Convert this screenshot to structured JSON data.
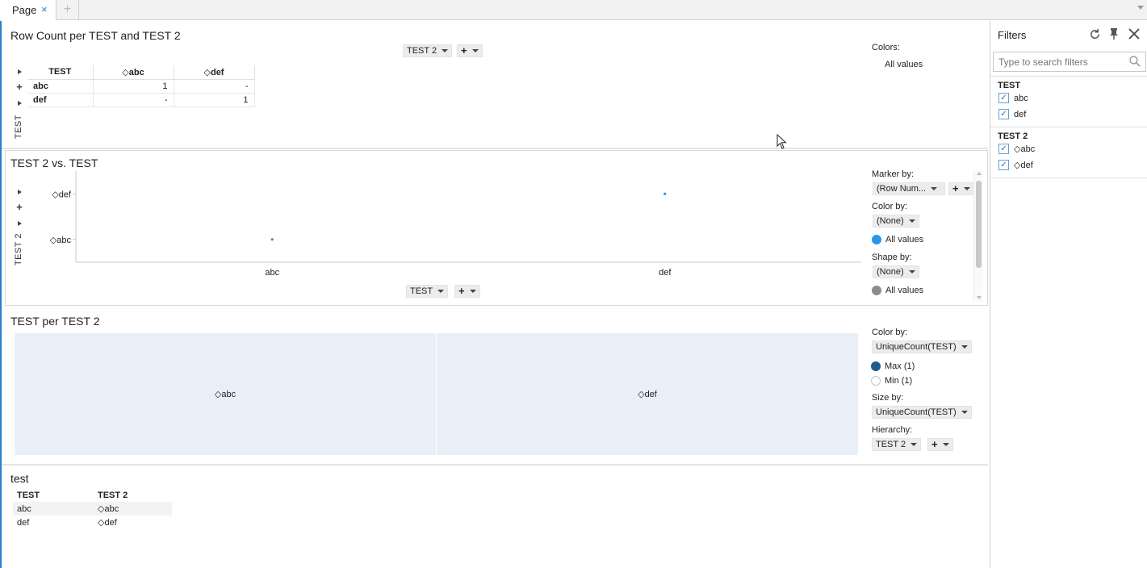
{
  "tabs": {
    "page_label": "Page",
    "close_icon": "×",
    "add_icon": "+"
  },
  "crosstable": {
    "title": "Row Count per TEST and TEST 2",
    "column_axis_label": "TEST 2",
    "row_axis_label": "TEST",
    "headers": [
      "TEST",
      "◇abc",
      "◇def"
    ],
    "rows": [
      {
        "label": "abc",
        "values": [
          "1",
          "-"
        ]
      },
      {
        "label": "def",
        "values": [
          "-",
          "1"
        ]
      }
    ],
    "legend_title": "Colors:",
    "legend_value": "All values"
  },
  "scatter": {
    "title": "TEST 2 vs. TEST",
    "x_axis_selector": "TEST",
    "y_axis_label": "TEST 2",
    "marker_by_label": "Marker by:",
    "marker_by_value": "(Row Num...",
    "color_by_label": "Color by:",
    "color_by_value": "(None)",
    "color_legend": "All values",
    "shape_by_label": "Shape by:",
    "shape_by_value": "(None)",
    "shape_legend": "All values",
    "marker_color": "#3b8fd6"
  },
  "chart_data": {
    "type": "scatter",
    "x_categories": [
      "abc",
      "def"
    ],
    "y_categories": [
      "◇abc",
      "◇def"
    ],
    "points": [
      {
        "x": "abc",
        "y": "◇abc"
      },
      {
        "x": "def",
        "y": "◇def"
      }
    ]
  },
  "treemap": {
    "title": "TEST per TEST 2",
    "tiles": [
      "◇abc",
      "◇def"
    ],
    "tile_color": "#e8eff8",
    "color_by_label": "Color by:",
    "color_by_value": "UniqueCount(TEST)",
    "max_label": "Max (1)",
    "min_label": "Min (1)",
    "max_color": "#1f5d8c",
    "size_by_label": "Size by:",
    "size_by_value": "UniqueCount(TEST)",
    "hierarchy_label": "Hierarchy:",
    "hierarchy_value": "TEST 2"
  },
  "table": {
    "title": "test",
    "headers": [
      "TEST",
      "TEST 2"
    ],
    "rows": [
      [
        "abc",
        "◇abc"
      ],
      [
        "def",
        "◇def"
      ]
    ]
  },
  "filters": {
    "title": "Filters",
    "search_placeholder": "Type to search filters",
    "groups": [
      {
        "name": "TEST",
        "items": [
          "abc",
          "def"
        ]
      },
      {
        "name": "TEST 2",
        "items": [
          "◇abc",
          "◇def"
        ]
      }
    ]
  }
}
